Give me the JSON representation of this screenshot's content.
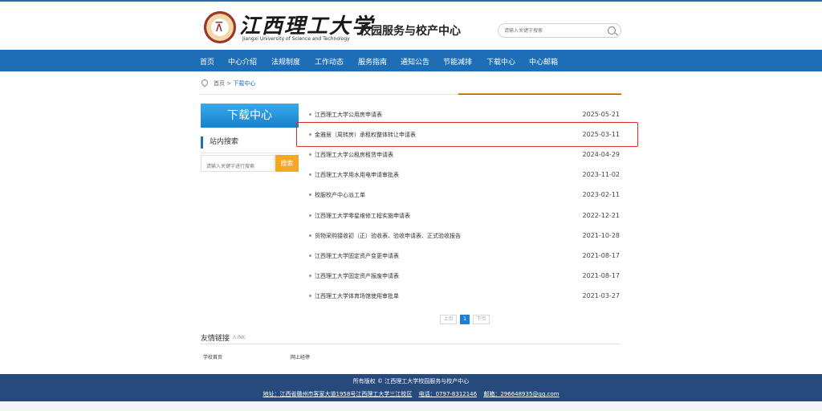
{
  "header": {
    "logo_cn": "江西理工大学",
    "logo_en": "Jiangxi University of Science and Technology",
    "site_title": "校园服务与校产中心",
    "search_placeholder": "请输入关键字搜索"
  },
  "nav": [
    "首页",
    "中心介绍",
    "法规制度",
    "工作动态",
    "服务指南",
    "通知公告",
    "节能减排",
    "下载中心",
    "中心邮箱"
  ],
  "breadcrumb": {
    "home": "首页 >",
    "current": "下载中心"
  },
  "sidebar": {
    "title": "下载中心",
    "search_label": "站内搜索",
    "search_placeholder": "请输入关键字进行搜索",
    "search_button": "搜索"
  },
  "list": [
    {
      "title": "江西理工大学公用房申请表",
      "date": "2025-05-21"
    },
    {
      "title": "金雅居（周转房）承租权整体转让申请表",
      "date": "2025-03-11"
    },
    {
      "title": "江西理工大学公租房租赁申请表",
      "date": "2024-04-29"
    },
    {
      "title": "江西理工大学用水用电申请审批表",
      "date": "2023-11-02"
    },
    {
      "title": "校服校产中心派工单",
      "date": "2023-02-11"
    },
    {
      "title": "江西理工大学零星维修工程实施申请表",
      "date": "2022-12-21"
    },
    {
      "title": "货物采购接收初（正）验收表、验收申请表、正式验收报告",
      "date": "2021-10-28"
    },
    {
      "title": "江西理工大学固定资产变更申请表",
      "date": "2021-08-17"
    },
    {
      "title": "江西理工大学固定资产报废申请表",
      "date": "2021-08-17"
    },
    {
      "title": "江西理工大学体育场馆使用审批单",
      "date": "2021-03-27"
    }
  ],
  "pager": {
    "prev": "上页",
    "current": "1",
    "next": "下页"
  },
  "friend_links": {
    "title": "友情链接",
    "title_en": "/LINK",
    "items": [
      "学校首页",
      "网上经停"
    ]
  },
  "footer": {
    "copyright": "所有版权 © 江西理工大学校园服务与校产中心",
    "address": "地址：江西省赣州市客家大道1958号江西理工大学三江校区",
    "phone": "电话：0797-8312146",
    "email": "邮箱：296648935@qq.com"
  },
  "colors": {
    "brand_blue": "#1d6db7",
    "accent_orange": "#f5a623",
    "highlight_red": "#e02b2b",
    "footer_blue": "#254a7b"
  }
}
